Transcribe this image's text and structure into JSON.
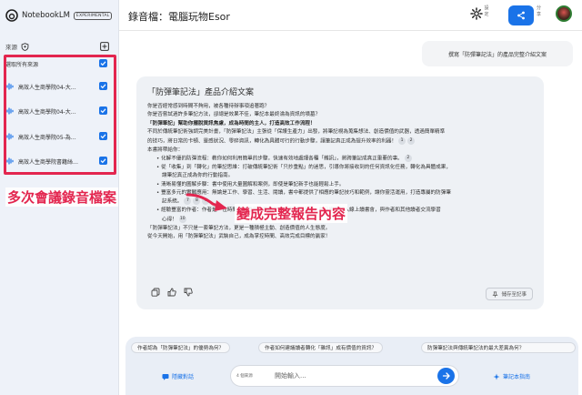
{
  "app": {
    "name": "NotebookLM",
    "badge": "EXPERIMENTAL"
  },
  "header": {
    "title": "錄音檔：電腦玩物Esor",
    "settings_label": "設\n定",
    "share_label": "分\n享",
    "colors": {
      "accent": "#1a73e8"
    }
  },
  "sidebar": {
    "sources_label": "來源",
    "select_all_label": "選取所有來源",
    "items": [
      {
        "label": "高效人生商學院04-大…",
        "checked": true
      },
      {
        "label": "高效人生商學院04-大…",
        "checked": true
      },
      {
        "label": "高效人生商學院05-為…",
        "checked": true
      },
      {
        "label": "高效人生商學院書籍絲…",
        "checked": true
      }
    ]
  },
  "main": {
    "suggest_bubble": "撰寫「防彈筆記法」的產品完整介紹文案",
    "doc": {
      "title": "「防彈筆記法」產品介紹文案",
      "lines": [
        {
          "text": "你是否經常感到時間不夠用，被各種待辦事項追著跑？",
          "style": "",
          "cite": ""
        },
        {
          "text": "你是否嘗試過許多筆記方法，卻總是效果不佳，筆記本最終淪為資訊的墳墓？",
          "style": "",
          "cite": ""
        },
        {
          "text": "「防彈筆記」幫助你擺脫資訊焦慮，成為時間的主人，打造高效工作流程！",
          "style": "bold",
          "cite": ""
        },
        {
          "text": "不同於傳統筆記術強調完美計畫，「防彈筆記法」主張從「保護生產力」出發，將筆記視為蒐集想法、創造價值的武器，透過簡單精準",
          "style": "",
          "cite": ""
        },
        {
          "text": "的技巧，將日常的卡頓、靈感狀況、零碎資訊，轉化為具體可行的行動步驟，讓筆記真正成為提升效率的利器！",
          "style": "",
          "cite": "1 2"
        },
        {
          "text": "本書將帶給你：",
          "style": "",
          "cite": ""
        },
        {
          "text": "• 化解不優的防彈流程：教你如何利用簡單的步驟，快速有效地處理各種「雜訊」，將跨筆記成真正重要的事。",
          "style": "b",
          "cite": "2"
        },
        {
          "text": "• 從「收集」到「轉化」的筆記思維：打破傳統筆記術「只抄重點」的迷思，引導你將接收到的任何資訊化任務，轉化為具體成果，",
          "style": "b",
          "cite": ""
        },
        {
          "text": "讓筆記真正成為你的行動指南。",
          "style": "bc",
          "cite": ""
        },
        {
          "text": "• 清晰易懂的圖解步驟：書中使用大量圖解和案例，即使是筆記新手也能輕鬆上手。",
          "style": "b",
          "cite": ""
        },
        {
          "text": "• 豐富多元的實戰應用：無論是工作、學習、生活、閱讀，書中都提供了相應的筆記技巧和範例，讓你靈活運用，打造專屬的防彈筆",
          "style": "b",
          "cite": ""
        },
        {
          "text": "記系統。",
          "style": "bc",
          "cite": "7 8 9"
        },
        {
          "text": "• 經驗豐富的作者：作者是一位時間管理專家，筆記引導者與實用資源，並且樂意加入線上讀書會，與作者和其他讀者交流學習",
          "style": "b",
          "cite": ""
        },
        {
          "text": "心得！",
          "style": "bc",
          "cite": "10"
        },
        {
          "text": "「防彈筆記法」不只是一套筆記方法，更是一種積極主動、創造價值的人生態度。",
          "style": "",
          "cite": ""
        },
        {
          "text": "從今天開始，用「防彈筆記法」武裝自己，成為掌控時間、高效完成目標的贏家！",
          "style": "",
          "cite": ""
        }
      ],
      "save_label": "儲存至記事"
    },
    "overlay": {
      "left": "多次會議錄音檔案",
      "right": "變成完整報告內容",
      "color": "#e3264f"
    }
  },
  "bottom": {
    "chips": [
      "作者認為「防彈筆記法」的優勢為何？",
      "作者如何建議讀者轉化「雜訊」成有價值的資訊？",
      "防彈筆記法與傳統筆記法的最大差異為何？"
    ],
    "sources_toggle": "隱藏對話",
    "source_count": "4 個來源",
    "input_placeholder": "開始輸入...",
    "guide_label": "筆記本指南"
  }
}
